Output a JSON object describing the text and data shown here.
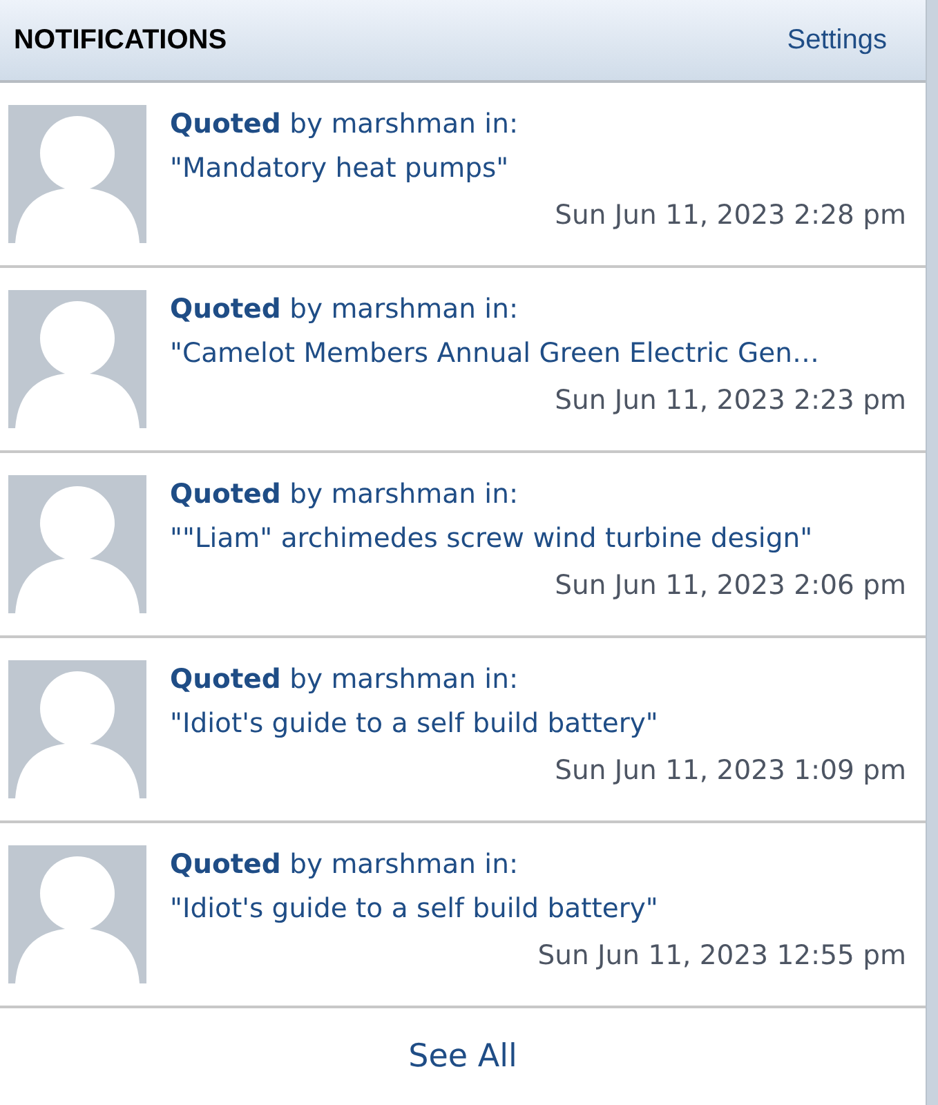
{
  "header": {
    "title": "NOTIFICATIONS",
    "settings_link": "Settings"
  },
  "notifications": [
    {
      "action": "**Quoted** by marshman in:",
      "topic": "\"Mandatory heat pumps\"",
      "time": "Sun Jun 11, 2023 2:28 pm"
    },
    {
      "action": "**Quoted** by marshman in:",
      "topic": "\"Camelot Members Annual Green Electric Gen…",
      "time": "Sun Jun 11, 2023 2:23 pm"
    },
    {
      "action": "**Quoted** by marshman in:",
      "topic": "\"\"Liam\" archimedes screw wind turbine design\"",
      "time": "Sun Jun 11, 2023 2:06 pm"
    },
    {
      "action": "**Quoted** by marshman in:",
      "topic": "\"Idiot's guide to a self build battery\"",
      "time": "Sun Jun 11, 2023 1:09 pm"
    },
    {
      "action": "**Quoted** by marshman in:",
      "topic": "\"Idiot's guide to a self build battery\"",
      "time": "Sun Jun 11, 2023 12:55 pm"
    }
  ],
  "footer": {
    "see_all": "See All"
  }
}
